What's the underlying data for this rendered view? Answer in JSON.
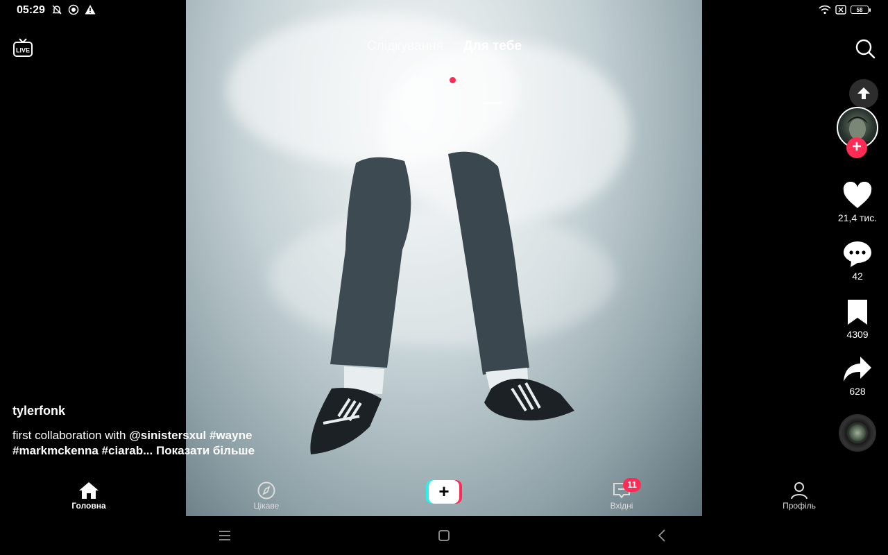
{
  "status_bar": {
    "time": "05:29",
    "battery": "58",
    "left_icons": [
      "muted-bell-icon",
      "record-icon",
      "warning-icon"
    ],
    "right_icons": [
      "wifi-icon",
      "sim-off-icon",
      "battery-icon"
    ]
  },
  "top_tabs": {
    "following": "Слідкування",
    "for_you": "Для тебе",
    "active": "for_you",
    "following_has_dot": true
  },
  "top_left": {
    "icon": "live-icon",
    "label": "LIVE"
  },
  "top_right": {
    "icon": "search-icon"
  },
  "rail": {
    "likes": "21,4 тис.",
    "comments": "42",
    "favorites": "4309",
    "shares": "628"
  },
  "caption": {
    "author": "tylerfonk",
    "text_plain": "first collaboration with ",
    "mention": "@sinistersxul",
    "tag1": " #wayne",
    "tag2": "#markmckenna",
    "tag3": "  #ciarab...",
    "more": "  Показати більше"
  },
  "bottom_nav": {
    "home": "Головна",
    "discover": "Цікаве",
    "inbox": "Вхідні",
    "profile": "Профіль",
    "inbox_badge": "11"
  },
  "colors": {
    "accent": "#fe2c55",
    "cyan": "#25f4ee",
    "background": "#000000"
  }
}
